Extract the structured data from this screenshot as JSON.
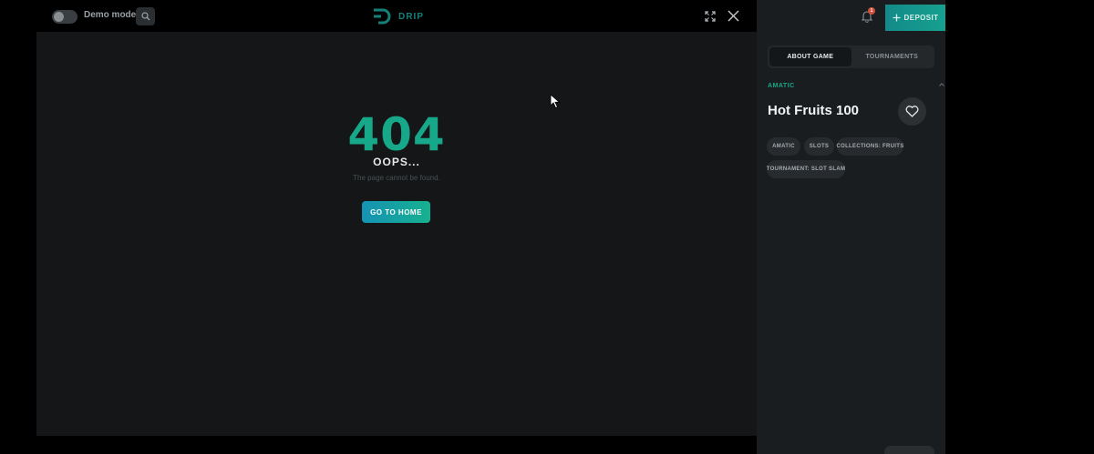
{
  "topbar": {
    "demo_label": "Demo mode",
    "logo_text": "DRIP"
  },
  "game": {
    "error_code": "404",
    "error_title": "OOPS...",
    "error_message": "The page cannot be found.",
    "home_button": "GO TO HOME"
  },
  "panel": {
    "notification_count": "1",
    "deposit_label": "DEPOSIT",
    "tabs": [
      {
        "label": "ABOUT GAME",
        "active": true
      },
      {
        "label": "TOURNAMENTS",
        "active": false
      }
    ],
    "provider": "AMATIC",
    "game_title": "Hot Fruits 100",
    "tags": [
      "AMATIC",
      "SLOTS",
      "COLLECTIONS: FRUITS",
      "TOURNAMENT: SLOT SLAM"
    ]
  },
  "colors": {
    "accent": "#17a88a",
    "panel_bg": "#1a1d1f",
    "frame_bg": "#141617"
  }
}
